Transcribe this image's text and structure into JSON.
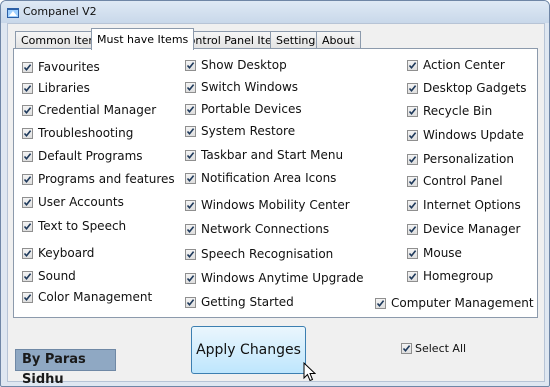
{
  "window": {
    "title": "Companel V2"
  },
  "tabs": [
    {
      "label": "Common Items",
      "active": false
    },
    {
      "label": "Must have Items",
      "active": true
    },
    {
      "label": "Control Panel Items",
      "active": false
    },
    {
      "label": "Settings",
      "active": false
    },
    {
      "label": "About",
      "active": false
    }
  ],
  "items": {
    "col1": [
      "Favourites",
      "Libraries",
      "Credential Manager",
      "Troubleshooting",
      "Default Programs",
      "Programs and features",
      "User Accounts",
      "Text to Speech",
      "Keyboard",
      "Sound",
      "Color Management"
    ],
    "col2": [
      "Show Desktop",
      "Switch Windows",
      "Portable Devices",
      "System Restore",
      "Taskbar and Start Menu",
      "Notification Area Icons",
      "Windows Mobility Center",
      "Network Connections",
      "Speech Recognisation",
      "Windows Anytime Upgrade",
      "Getting Started"
    ],
    "col3": [
      "Action Center",
      "Desktop Gadgets",
      "Recycle Bin",
      "Windows Update",
      "Personalization",
      "Control Panel",
      "Internet Options",
      "Device Manager",
      "Mouse",
      "Homegroup",
      "Computer Management"
    ]
  },
  "author_label": "By Paras Sidhu",
  "apply_label": "Apply Changes",
  "select_all_label": "Select All",
  "all_checked": true,
  "colors": {
    "accent": "#3c7fb1",
    "check": "#1e395b",
    "author_bg": "#8fa8c3"
  }
}
